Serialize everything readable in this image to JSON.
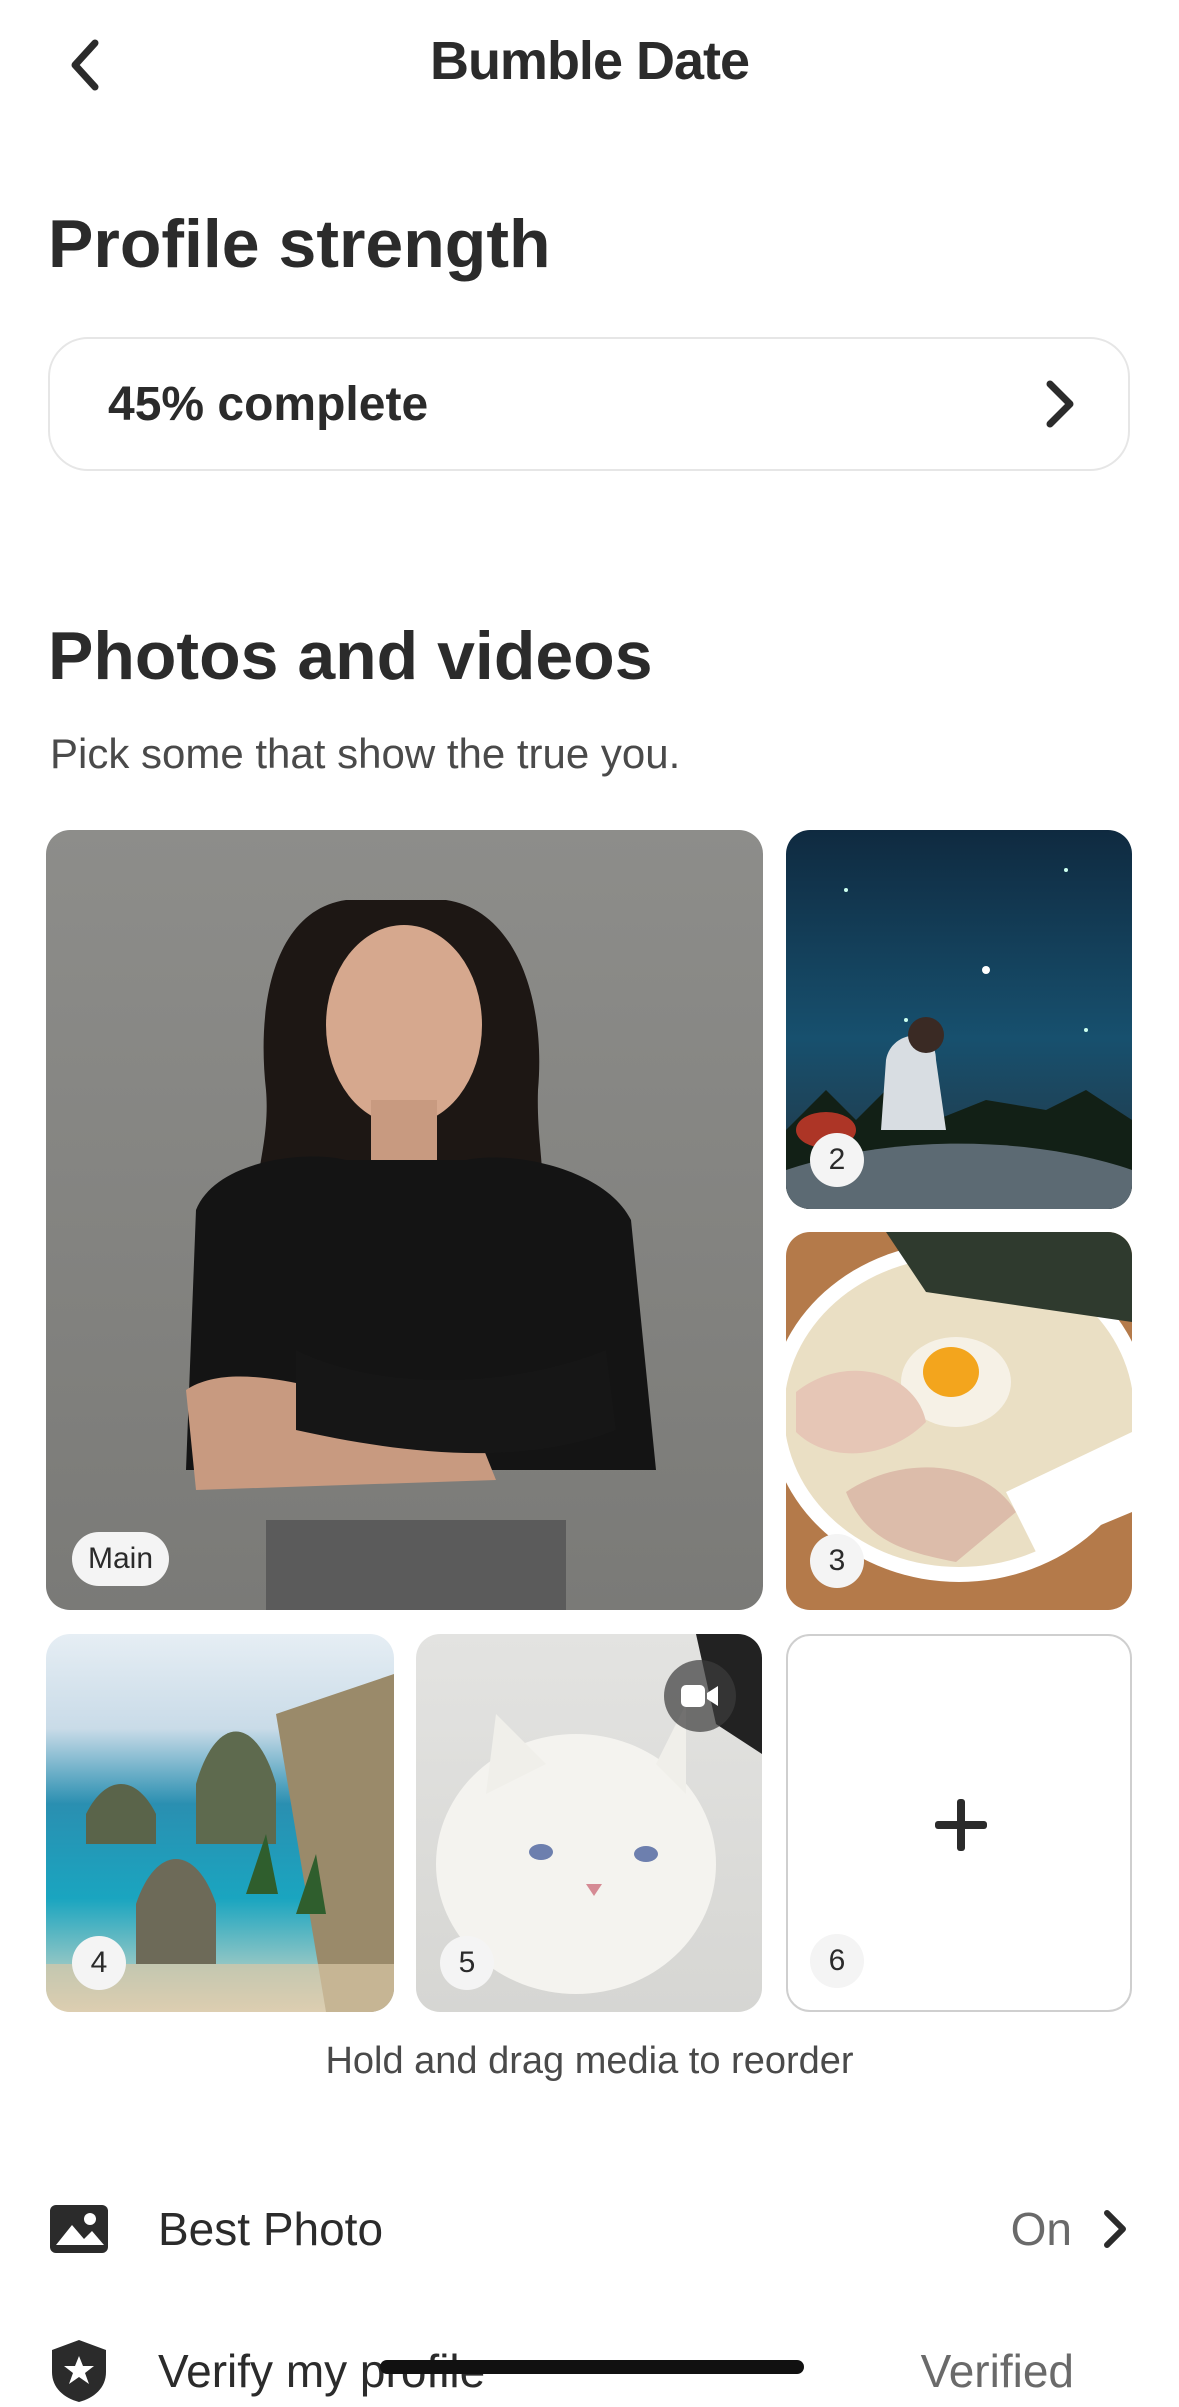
{
  "header": {
    "title": "Bumble Date",
    "back_icon": "chevron-left-icon"
  },
  "profile_strength": {
    "heading": "Profile strength",
    "progress_label": "45% complete",
    "progress_value": 0.45
  },
  "media": {
    "heading": "Photos and videos",
    "subtitle": "Pick some that show the true you.",
    "slots": [
      {
        "badge": "Main",
        "content": "portrait of woman with arms crossed"
      },
      {
        "badge": "2",
        "content": "person sitting under starry night sky"
      },
      {
        "badge": "3",
        "content": "bowl of ramen with egg"
      },
      {
        "badge": "4",
        "content": "coastal cliffs and beach"
      },
      {
        "badge": "5",
        "content": "white cat",
        "type": "video"
      },
      {
        "badge": "6",
        "content": "empty",
        "add_icon": "plus-icon"
      }
    ],
    "hint": "Hold and drag media to reorder"
  },
  "settings": [
    {
      "label": "Best Photo",
      "value": "On",
      "icon": "image-icon"
    },
    {
      "label": "Verify my profile",
      "value": "Verified",
      "icon": "verified-badge-icon"
    }
  ],
  "colors": {
    "text": "#2b2b2b",
    "border": "#e6e6e6",
    "badge_bg": "#f4f4f4"
  }
}
